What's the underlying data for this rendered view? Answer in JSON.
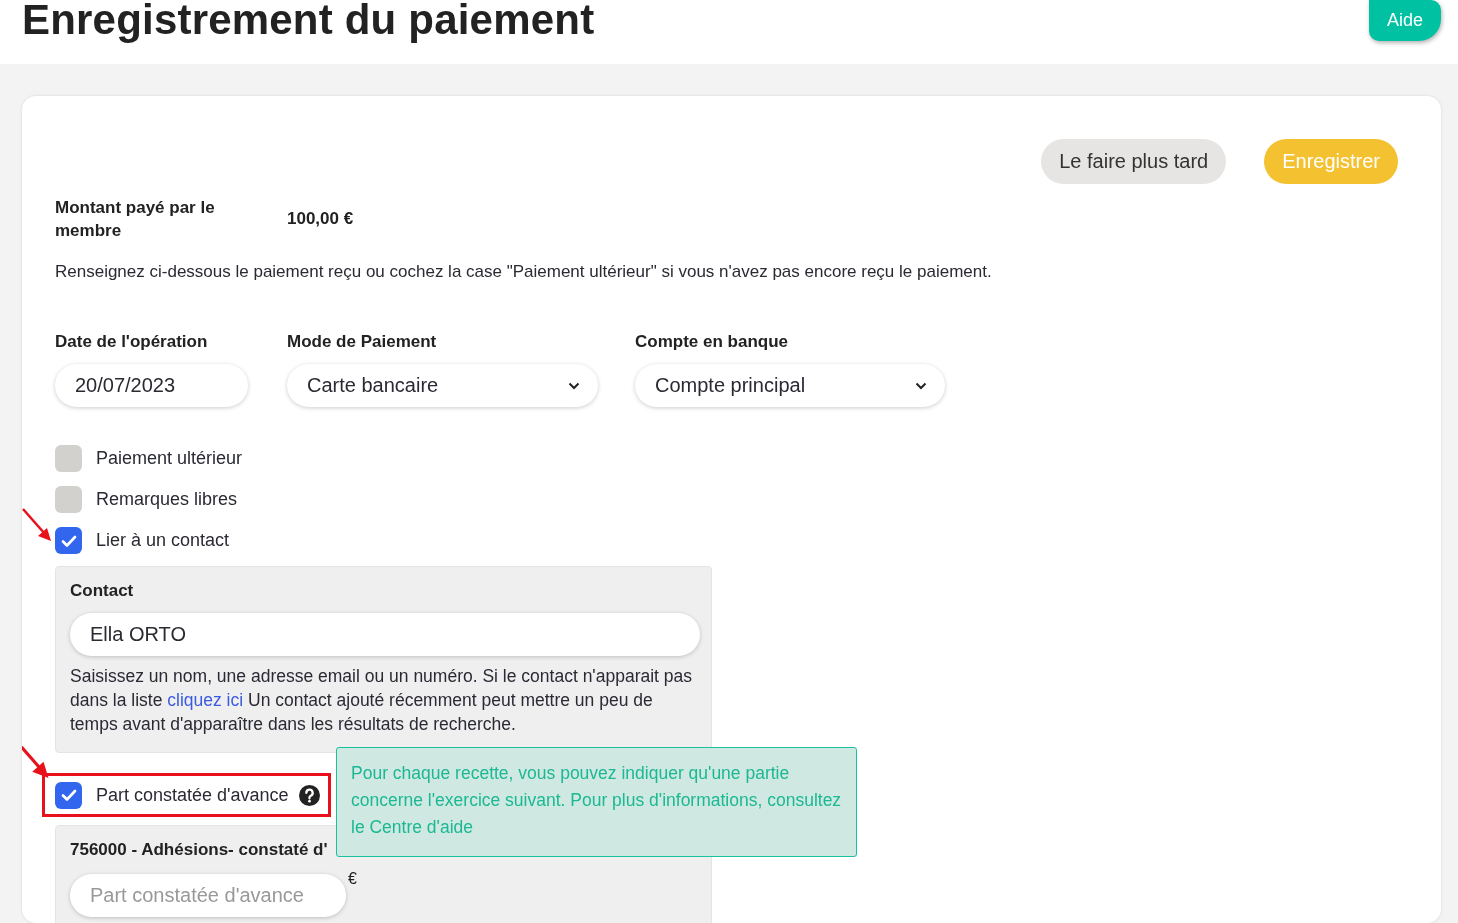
{
  "header": {
    "title": "Enregistrement du paiement",
    "help_button": "Aide"
  },
  "actions": [
    {
      "label": "Le faire plus tard",
      "kind": "secondary"
    },
    {
      "label": "Enregistrer",
      "kind": "primary"
    }
  ],
  "amount": {
    "label": "Montant payé par le membre",
    "value": "100,00 €"
  },
  "instructions": "Renseignez ci-dessous le paiement reçu ou cochez la case \"Paiement ultérieur\" si vous n'avez pas encore reçu le paiement.",
  "fields": [
    {
      "label": "Date de l'opération",
      "value": "20/07/2023",
      "kind": "text"
    },
    {
      "label": "Mode de Paiement",
      "value": "Carte bancaire",
      "kind": "select"
    },
    {
      "label": "Compte en banque",
      "value": "Compte principal",
      "kind": "select"
    }
  ],
  "options": [
    {
      "label": "Paiement ultérieur",
      "checked": false,
      "annotated": false
    },
    {
      "label": "Remarques libres",
      "checked": false,
      "annotated": false
    },
    {
      "label": "Lier à un contact",
      "checked": true,
      "annotated": true
    }
  ],
  "contact": {
    "label": "Contact",
    "value": "Ella ORTO",
    "help_before": "Saisissez un nom, une adresse email ou un numéro. Si le contact n'apparait pas dans la liste ",
    "help_link": "cliquez ici",
    "help_after": " Un contact ajouté récemment peut mettre un peu de temps avant d'apparaître dans les résultats de recherche."
  },
  "deferred": {
    "label": "Part constatée d'avance",
    "checked": true,
    "annotated": true,
    "highlighted": true,
    "tooltip": "Pour chaque recette, vous pouvez indiquer qu'une partie concerne l'exercice suivant. Pour plus d'informations, consultez le Centre d'aide",
    "account_label": "756000 - Adhésions- constaté d'",
    "amount_placeholder": "Part constatée d'avance",
    "currency": "€"
  }
}
